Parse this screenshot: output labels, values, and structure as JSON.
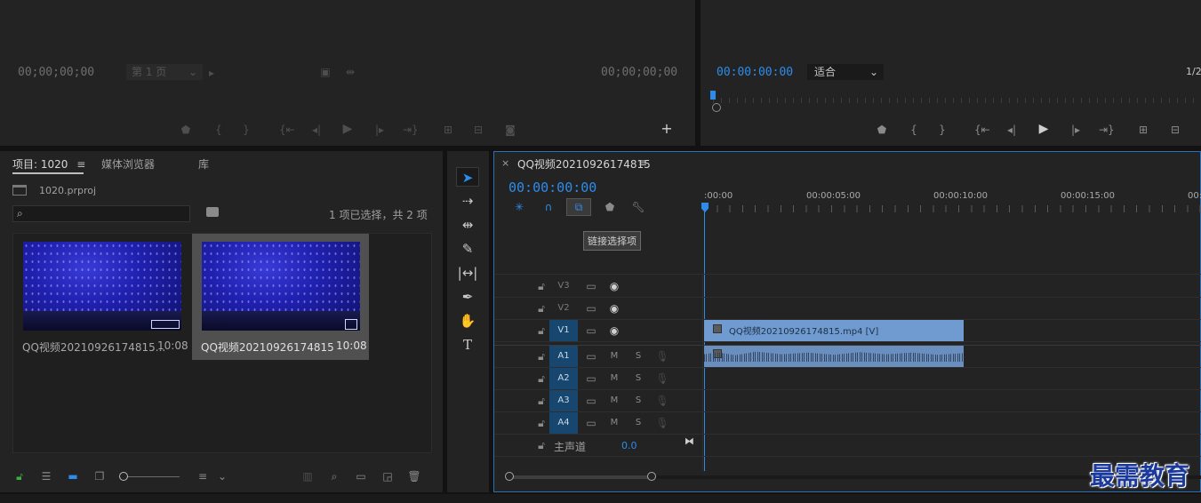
{
  "source_monitor": {
    "timecode_left": "00;00;00;00",
    "page_select": "第 1 页",
    "timecode_right": "00;00;00;00",
    "add_icon": "plus-icon"
  },
  "program_monitor": {
    "timecode": "00:00:00:00",
    "fit_select": "适合",
    "ratio": "1/2"
  },
  "project": {
    "tabs": [
      {
        "label": "项目: 1020"
      },
      {
        "label": "媒体浏览器"
      },
      {
        "label": "库"
      }
    ],
    "file_name": "1020.prproj",
    "search_placeholder": "",
    "selection_status": "1 项已选择，共 2 项",
    "items": [
      {
        "name": "QQ视频20210926174815...",
        "duration": "10:08"
      },
      {
        "name": "QQ视频20210926174815",
        "duration": "10:08"
      }
    ]
  },
  "timeline": {
    "tab_title": "QQ视频20210926174815",
    "close": "×",
    "timecode": "00:00:00:00",
    "tooltip": "链接选择项",
    "ruler": [
      ":00:00",
      "00:00:05:00",
      "00:00:10:00",
      "00:00:15:00",
      "00:"
    ],
    "video_tracks": [
      {
        "name": "V3",
        "target": ""
      },
      {
        "name": "V2",
        "target": ""
      },
      {
        "name": "V1",
        "target": "V1"
      }
    ],
    "audio_tracks": [
      {
        "name": "A1",
        "target": "A1",
        "m": "M",
        "s": "S"
      },
      {
        "name": "A2",
        "target": "A2",
        "m": "M",
        "s": "S"
      },
      {
        "name": "A3",
        "target": "A3",
        "m": "M",
        "s": "S"
      },
      {
        "name": "A4",
        "target": "A4",
        "m": "M",
        "s": "S"
      }
    ],
    "master": {
      "label": "主声道",
      "value": "0.0"
    },
    "video_clip": "QQ视频20210926174815.mp4 [V]"
  },
  "watermark": "最需教育",
  "colors": {
    "accent": "#2d8ceb",
    "clip_video": "#6f9bd1",
    "clip_audio": "#6a8fbf",
    "track_target": "#17476e"
  }
}
